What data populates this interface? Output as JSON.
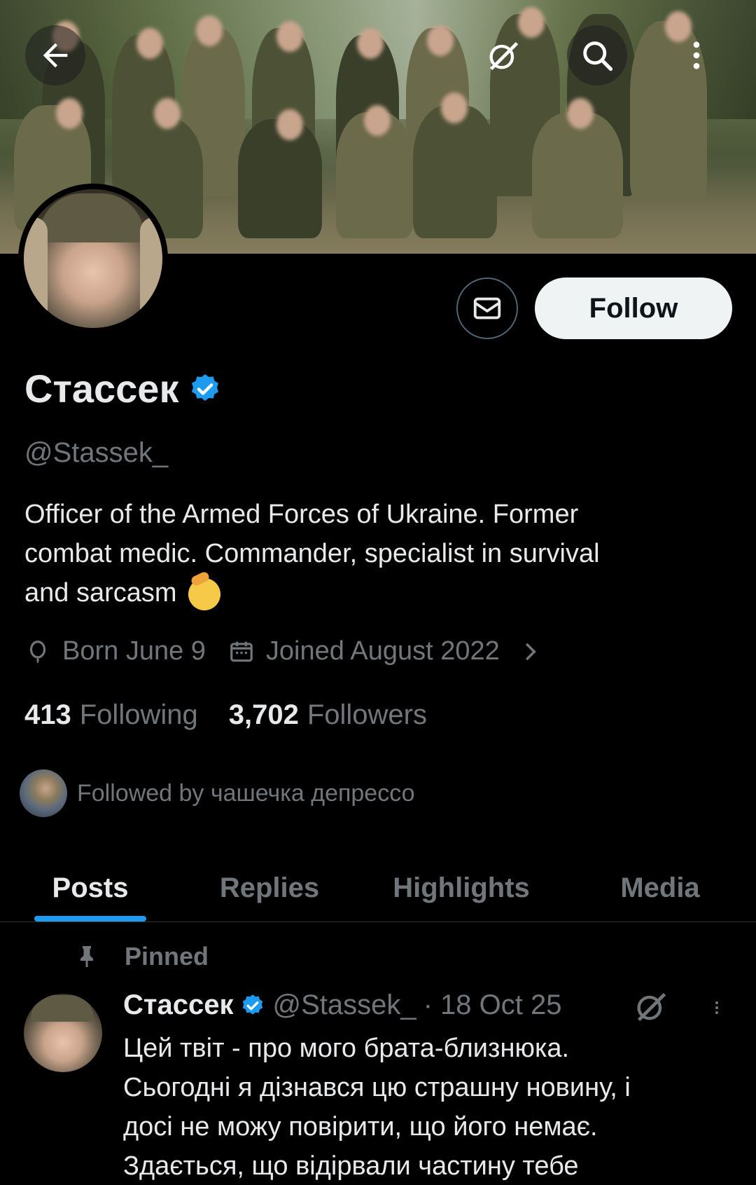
{
  "banner": {
    "back_icon": "arrow-left-icon",
    "grok_icon": "grok-icon",
    "search_icon": "search-icon",
    "more_icon": "more-vertical-icon"
  },
  "profile": {
    "name": "Стассек",
    "verified": true,
    "handle": "@Stassek_",
    "bio_line1": "Officer of the Armed Forces of Ukraine. Former",
    "bio_line2": "combat medic. Commander, specialist in survival",
    "bio_line3": "and sarcasm",
    "born": "Born June 9",
    "joined": "Joined August 2022",
    "following_count": "413",
    "following_label": "Following",
    "followers_count": "3,702",
    "followers_label": "Followers",
    "followed_by": "Followed by чашечка депрессо"
  },
  "actions": {
    "follow_label": "Follow",
    "message_icon": "mail-icon"
  },
  "tabs": [
    {
      "label": "Posts",
      "active": true
    },
    {
      "label": "Replies",
      "active": false
    },
    {
      "label": "Highlights",
      "active": false
    },
    {
      "label": "Media",
      "active": false
    }
  ],
  "post": {
    "pinned_label": "Pinned",
    "author": "Стассек",
    "handle": "@Stassek_",
    "date": "· 18 Oct 25",
    "line1": "Цей твіт - про мого брата-близнюка.",
    "line2": "Сьогодні я дізнався цю страшну новину, і",
    "line3": "досі не можу повірити, що його немає.",
    "line4": "Здається, що відірвали частину тебе"
  },
  "colors": {
    "accent": "#1d9bf0",
    "muted": "#71767b",
    "text": "#e7e9ea",
    "background": "#000000"
  }
}
